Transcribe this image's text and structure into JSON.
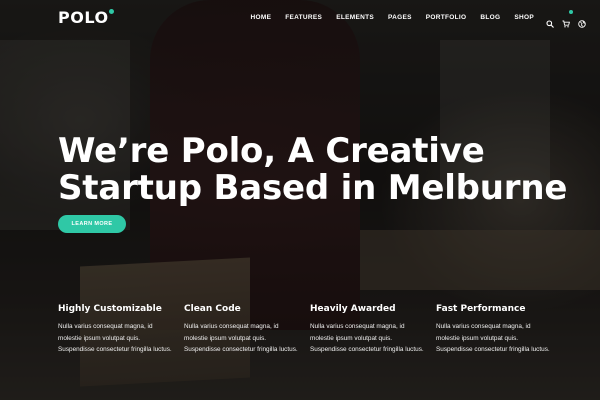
{
  "header": {
    "logo": "POLO",
    "nav": [
      "HOME",
      "FEATURES",
      "ELEMENTS",
      "PAGES",
      "PORTFOLIO",
      "BLOG",
      "SHOP"
    ],
    "icons": [
      "search-icon",
      "cart-icon",
      "globe-icon"
    ]
  },
  "hero": {
    "line1": "We’re Polo, A Creative",
    "line2": "Startup Based in Melburne",
    "cta": "LEARN MORE"
  },
  "features": [
    {
      "title": "Highly Customizable",
      "lines": [
        "Nulla varius consequat magna, id",
        "molestie ipsum volutpat quis.",
        "Suspendisse consectetur fringilla luctus."
      ]
    },
    {
      "title": "Clean Code",
      "lines": [
        "Nulla varius consequat magna, id",
        "molestie ipsum volutpat quis.",
        "Suspendisse consectetur fringilla luctus."
      ]
    },
    {
      "title": "Heavily Awarded",
      "lines": [
        "Nulla varius consequat magna, id",
        "molestie ipsum volutpat quis.",
        "Suspendisse consectetur fringilla luctus."
      ]
    },
    {
      "title": "Fast Performance",
      "lines": [
        "Nulla varius consequat magna, id",
        "molestie ipsum volutpat quis.",
        "Suspendisse consectetur fringilla luctus."
      ]
    }
  ],
  "colors": {
    "accent": "#2fc8a6",
    "text": "#ffffff"
  }
}
